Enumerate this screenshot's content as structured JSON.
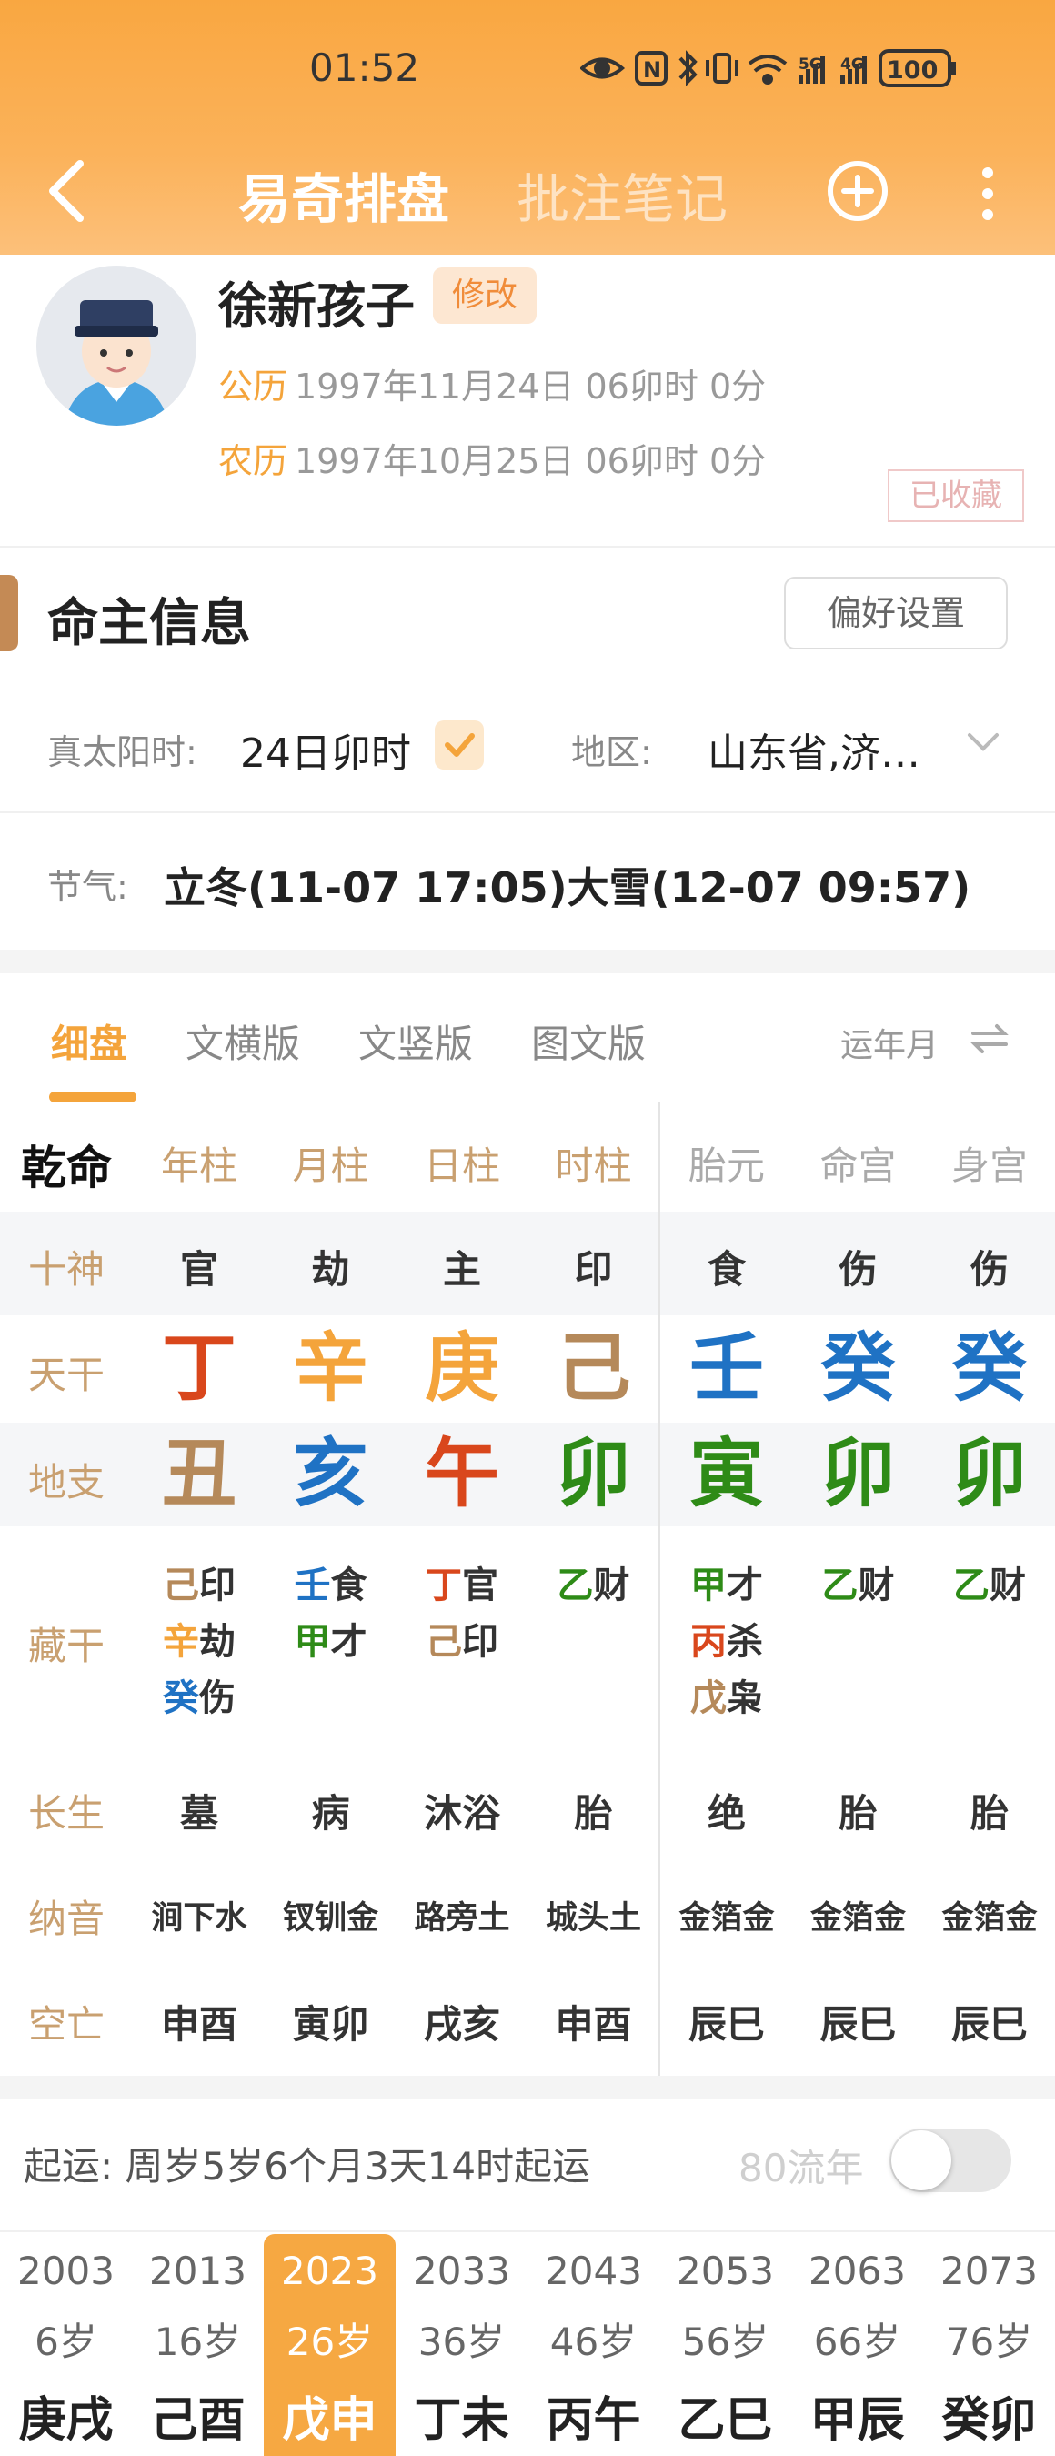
{
  "status": {
    "time": "01:52",
    "battery": "100",
    "net1": "5G",
    "net2": "4G"
  },
  "nav": {
    "active_tab": "易奇排盘",
    "inactive_tab": "批注笔记"
  },
  "profile": {
    "name": "徐新孩子",
    "edit_label": "修改",
    "solar_label": "公历",
    "solar_value": "1997年11月24日 06卯时 0分",
    "lunar_label": "农历",
    "lunar_value": "1997年10月25日 06卯时 0分",
    "saved_stamp": "已收藏"
  },
  "info": {
    "title": "命主信息",
    "pref_button": "偏好设置",
    "solar_time_label": "真太阳时:",
    "solar_time_value": "24日卯时",
    "region_label": "地区:",
    "region_value": "山东省,济…",
    "jieqi_label": "节气:",
    "jieqi_value": "立冬(11-07 17:05)大雪(12-07 09:57)"
  },
  "view_tabs": [
    "细盘",
    "文横版",
    "文竖版",
    "图文版"
  ],
  "yunnian_label": "运年月",
  "chart": {
    "qianming": "乾命",
    "columns": [
      {
        "label": "年柱",
        "shishen": "官",
        "tiangan": "丁",
        "dizhi": "丑",
        "canggan": [
          [
            "己",
            "印"
          ],
          [
            "辛",
            "劫"
          ],
          [
            "癸",
            "伤"
          ]
        ],
        "changsheng": "墓",
        "nayin": "涧下水",
        "kongwang": "申酉"
      },
      {
        "label": "月柱",
        "shishen": "劫",
        "tiangan": "辛",
        "dizhi": "亥",
        "canggan": [
          [
            "壬",
            "食"
          ],
          [
            "甲",
            "才"
          ]
        ],
        "changsheng": "病",
        "nayin": "钗钏金",
        "kongwang": "寅卯"
      },
      {
        "label": "日柱",
        "shishen": "主",
        "tiangan": "庚",
        "dizhi": "午",
        "canggan": [
          [
            "丁",
            "官"
          ],
          [
            "己",
            "印"
          ]
        ],
        "changsheng": "沐浴",
        "nayin": "路旁土",
        "kongwang": "戌亥"
      },
      {
        "label": "时柱",
        "shishen": "印",
        "tiangan": "己",
        "dizhi": "卯",
        "canggan": [
          [
            "乙",
            "财"
          ]
        ],
        "changsheng": "胎",
        "nayin": "城头土",
        "kongwang": "申酉"
      },
      {
        "label": "胎元",
        "shishen": "食",
        "tiangan": "壬",
        "dizhi": "寅",
        "canggan": [
          [
            "甲",
            "才"
          ],
          [
            "丙",
            "杀"
          ],
          [
            "戊",
            "枭"
          ]
        ],
        "changsheng": "绝",
        "nayin": "金箔金",
        "kongwang": "辰巳"
      },
      {
        "label": "命宫",
        "shishen": "伤",
        "tiangan": "癸",
        "dizhi": "卯",
        "canggan": [
          [
            "乙",
            "财"
          ]
        ],
        "changsheng": "胎",
        "nayin": "金箔金",
        "kongwang": "辰巳"
      },
      {
        "label": "身宫",
        "shishen": "伤",
        "tiangan": "癸",
        "dizhi": "卯",
        "canggan": [
          [
            "乙",
            "财"
          ]
        ],
        "changsheng": "胎",
        "nayin": "金箔金",
        "kongwang": "辰巳"
      }
    ],
    "row_labels": {
      "shishen": "十神",
      "tiangan": "天干",
      "dizhi": "地支",
      "canggan": "藏干",
      "changsheng": "长生",
      "nayin": "纳音",
      "kongwang": "空亡"
    }
  },
  "element_colors": {
    "wood": "#2e8b17",
    "fire": "#d9471c",
    "earth": "#b5895a",
    "metal": "#f4a43b",
    "water": "#1f72c4"
  },
  "qiyun": {
    "label": "起运:",
    "value": "周岁5岁6个月3天14时起运",
    "liunian_label": "80流年",
    "toggle_on": false
  },
  "dayun": [
    {
      "year": "2003",
      "age": "6岁",
      "ganzhi": "庚戌"
    },
    {
      "year": "2013",
      "age": "16岁",
      "ganzhi": "己酉"
    },
    {
      "year": "2023",
      "age": "26岁",
      "ganzhi": "戊申",
      "active": true
    },
    {
      "year": "2033",
      "age": "36岁",
      "ganzhi": "丁未"
    },
    {
      "year": "2043",
      "age": "46岁",
      "ganzhi": "丙午"
    },
    {
      "year": "2053",
      "age": "56岁",
      "ganzhi": "乙巳"
    },
    {
      "year": "2063",
      "age": "66岁",
      "ganzhi": "甲辰"
    },
    {
      "year": "2073",
      "age": "76岁",
      "ganzhi": "癸卯"
    }
  ]
}
